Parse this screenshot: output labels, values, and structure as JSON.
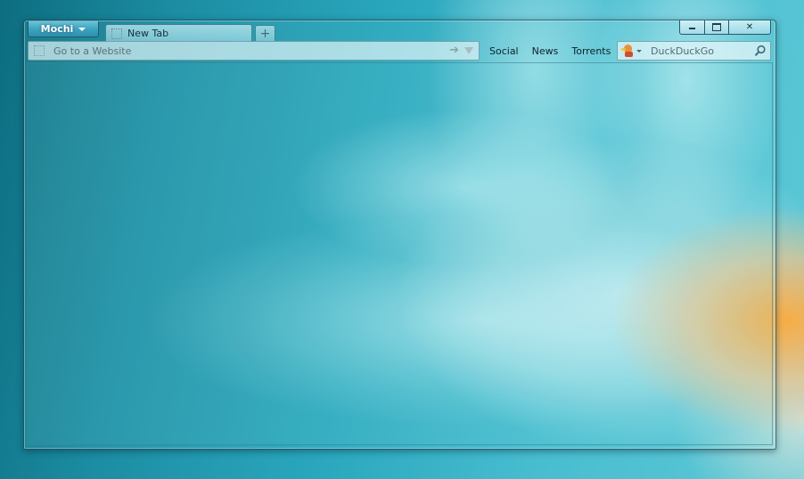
{
  "app_menu": {
    "label": "Mochi"
  },
  "tabs": [
    {
      "label": "New Tab"
    }
  ],
  "new_tab": {
    "icon": "plus-icon"
  },
  "window_controls": {
    "minimize_icon": "minimize-icon",
    "maximize_icon": "maximize-icon",
    "close_icon": "close-icon"
  },
  "address_bar": {
    "placeholder": "Go to a Website",
    "value": "",
    "go_icon": "arrow-right-icon",
    "dropmarker_icon": "chevron-down-icon"
  },
  "bookmarks": [
    {
      "label": "Social"
    },
    {
      "label": "News"
    },
    {
      "label": "Torrents"
    }
  ],
  "search": {
    "engine_icon": "duckduckgo-icon",
    "placeholder": "DuckDuckGo",
    "value": "",
    "submit_icon": "magnifier-icon"
  },
  "colors": {
    "accent": "#3da4bf",
    "desktop_teal": "#2aa7bd"
  }
}
